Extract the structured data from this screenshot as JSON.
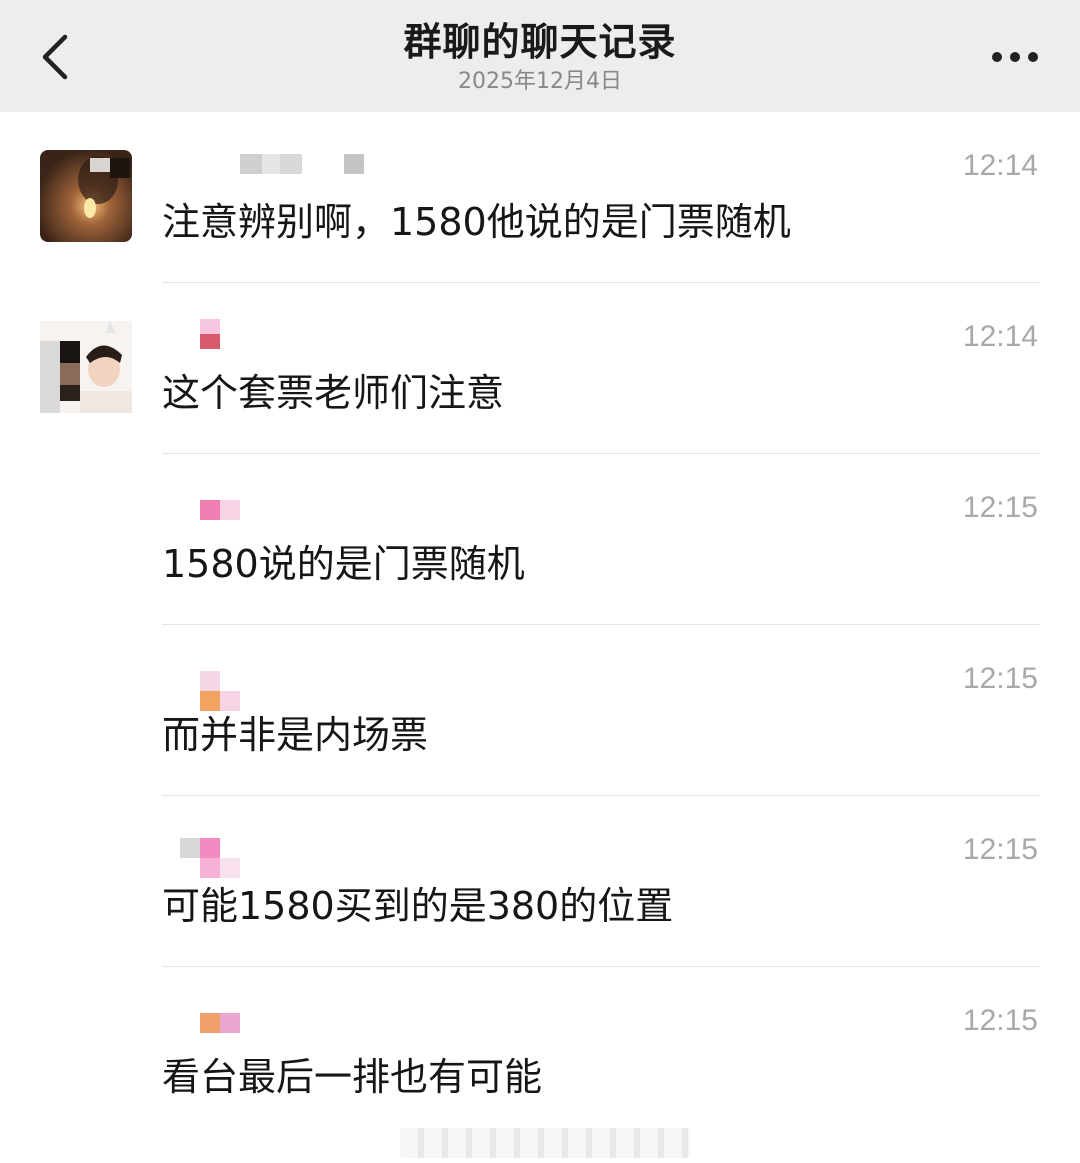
{
  "header": {
    "title": "群聊的聊天记录",
    "date": "2025年12月4日",
    "back_icon": "chevron-left-icon",
    "more_icon": "more-dots-icon"
  },
  "messages": [
    {
      "time": "12:14",
      "text": "注意辨别啊，1580他说的是门票随机",
      "show_avatar": true,
      "avatar": "avatar-candle",
      "name_pixels": [
        "#cfcfcf",
        "#bbbbbb",
        "#d8d8d8",
        "#c4c4c4"
      ]
    },
    {
      "time": "12:14",
      "text": "这个套票老师们注意",
      "show_avatar": true,
      "avatar": "avatar-person",
      "name_pixels": [
        "#f6c6e0",
        "#d85a6c"
      ]
    },
    {
      "time": "12:15",
      "text": "1580说的是门票随机",
      "show_avatar": false,
      "name_pixels": [
        "#f27fb1",
        "#f8d3e6"
      ]
    },
    {
      "time": "12:15",
      "text": "而并非是内场票",
      "show_avatar": false,
      "name_pixels": [
        "#f1a35f",
        "#f8d3e6"
      ]
    },
    {
      "time": "12:15",
      "text": "可能1580买到的是380的位置",
      "show_avatar": false,
      "name_pixels": [
        "#d8d8d8",
        "#f28cc0",
        "#f8d3e6"
      ]
    },
    {
      "time": "12:15",
      "text": "看台最后一排也有可能",
      "show_avatar": false,
      "name_pixels": [
        "#f0a06a",
        "#e9a6cf"
      ]
    }
  ]
}
